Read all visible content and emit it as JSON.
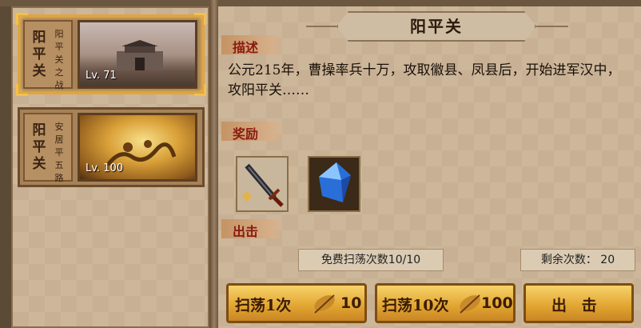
{
  "stages": [
    {
      "name": "阳平关",
      "subtitle": "阳平关之战",
      "level": "Lv. 71",
      "selected": true
    },
    {
      "name": "安居平五路",
      "subtitle": "安居平五路",
      "level": "Lv. 100",
      "selected": false
    }
  ],
  "stage_list_names": [
    "阳平关",
    "安居平五路"
  ],
  "title": "阳平关",
  "description_label": "描述",
  "description": "公元215年，曹操率兵十万，攻取徽县、凤县后，开始进军汉中，攻阳平关……",
  "rewards_label": "奖励",
  "rewards": [
    {
      "icon": "sword-icon"
    },
    {
      "icon": "blue-crystal-icon"
    }
  ],
  "attack_label": "出击",
  "free_sweeps": "免费扫荡次数10/10",
  "remaining": "剩余次数： 20",
  "buttons": {
    "sweep1": {
      "label": "扫荡1次",
      "cost": "10"
    },
    "sweep10": {
      "label": "扫荡10次",
      "cost": "100"
    },
    "attack": {
      "label": "出 击"
    }
  },
  "colors": {
    "accent": "#e1a53d",
    "title_red": "#8b1a10",
    "button": "#e1a430"
  }
}
